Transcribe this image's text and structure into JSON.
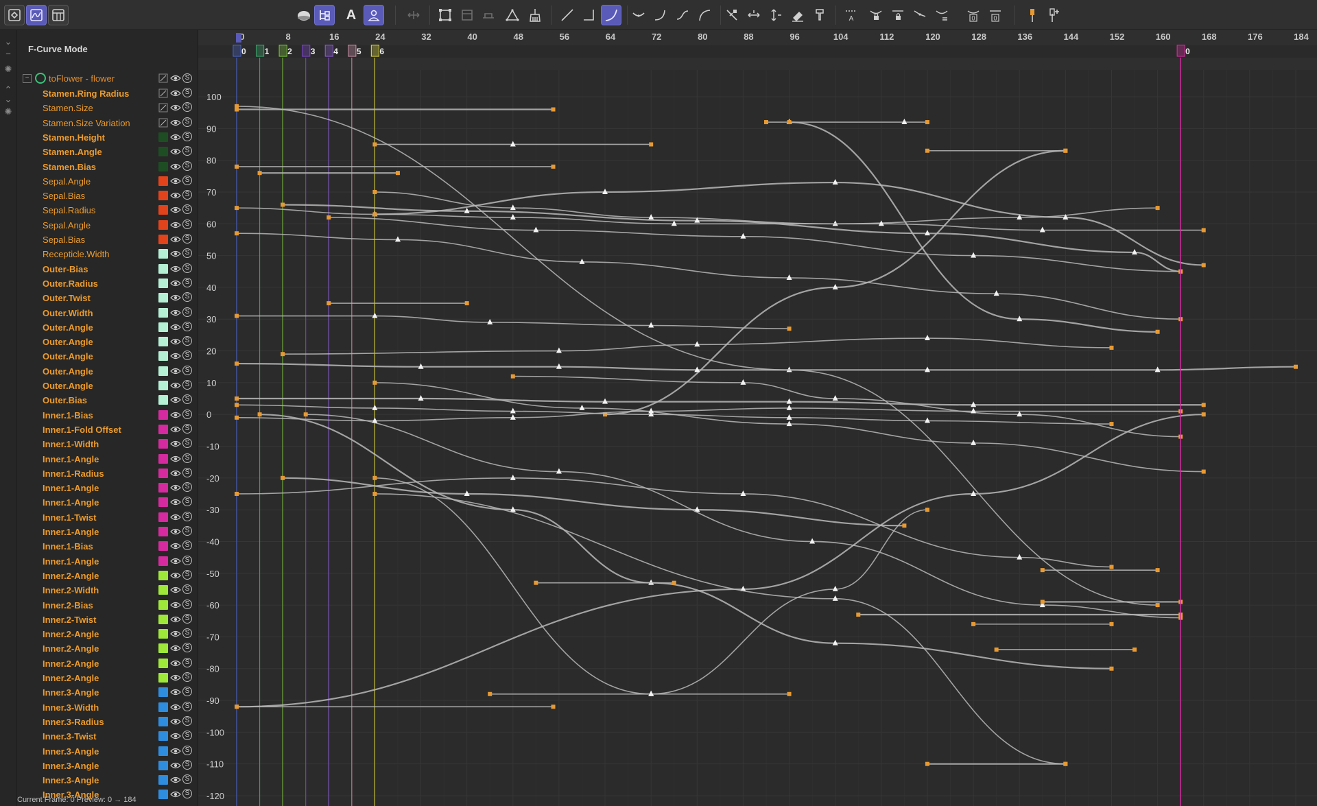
{
  "toolbar": {
    "text_tool_label": "A",
    "buttons": [
      "layout-key-icon",
      "fcurve-mode-icon",
      "dope-sheet-icon",
      "sphere-shading-icon",
      "hierarchy-icon",
      "text-tool-icon",
      "person-filter-icon",
      "move-icon",
      "frame-all-icon",
      "frame-selected-icon",
      "range-icon",
      "delta-icon",
      "broom-icon",
      "linear-curve-icon",
      "step-curve-icon",
      "ease-curve-icon",
      "bezier-smooth-icon",
      "ease-in-icon",
      "s-curve-icon",
      "ease-out-icon",
      "break-tangent-icon",
      "weight-horizontal-icon",
      "weight-vertical-icon",
      "eraser-icon",
      "stamp-icon",
      "auto-tangent-icon",
      "lock-tangent-icon",
      "lock-tangent-2-icon",
      "flat-tangent-icon",
      "tangent-equal-icon",
      "zero-tangent-icon",
      "zero-tangent-2-icon",
      "marker-icon",
      "add-marker-icon"
    ],
    "zero_labels": [
      "0",
      "0"
    ]
  },
  "panel": {
    "mode_label": "F-Curve Mode",
    "group_name": "toFlower - flower",
    "group_toggle": "−",
    "solo_label": "S"
  },
  "tracks": [
    {
      "name": "Stamen.Ring Radius",
      "color": "#1f4d23",
      "bold": true,
      "icon": "edit"
    },
    {
      "name": "Stamen.Size",
      "color": "#1f4d23",
      "bold": false,
      "icon": "edit"
    },
    {
      "name": "Stamen.Size Variation",
      "color": "#1f4d23",
      "bold": false,
      "icon": "edit"
    },
    {
      "name": "Stamen.Height",
      "color": "#1f4d23",
      "bold": true
    },
    {
      "name": "Stamen.Angle",
      "color": "#1f4d23",
      "bold": true
    },
    {
      "name": "Stamen.Bias",
      "color": "#1f4d23",
      "bold": true
    },
    {
      "name": "Sepal.Angle",
      "color": "#e2431b",
      "bold": false
    },
    {
      "name": "Sepal.Bias",
      "color": "#e2431b",
      "bold": false
    },
    {
      "name": "Sepal.Radius",
      "color": "#e2431b",
      "bold": false
    },
    {
      "name": "Sepal.Angle",
      "color": "#e2431b",
      "bold": false
    },
    {
      "name": "Sepal.Bias",
      "color": "#e2431b",
      "bold": false
    },
    {
      "name": "Recepticle.Width",
      "color": "#b5f0d4",
      "bold": false
    },
    {
      "name": "Outer-Bias",
      "color": "#b5f0d4",
      "bold": true
    },
    {
      "name": "Outer.Radius",
      "color": "#b5f0d4",
      "bold": true
    },
    {
      "name": "Outer.Twist",
      "color": "#b5f0d4",
      "bold": true
    },
    {
      "name": "Outer.Width",
      "color": "#b5f0d4",
      "bold": true
    },
    {
      "name": "Outer.Angle",
      "color": "#b5f0d4",
      "bold": true
    },
    {
      "name": "Outer.Angle",
      "color": "#b5f0d4",
      "bold": true
    },
    {
      "name": "Outer.Angle",
      "color": "#b5f0d4",
      "bold": true
    },
    {
      "name": "Outer.Angle",
      "color": "#b5f0d4",
      "bold": true
    },
    {
      "name": "Outer.Angle",
      "color": "#b5f0d4",
      "bold": true
    },
    {
      "name": "Outer.Bias",
      "color": "#b5f0d4",
      "bold": true
    },
    {
      "name": "Inner.1-Bias",
      "color": "#d62aa0",
      "bold": true
    },
    {
      "name": "Inner.1-Fold Offset",
      "color": "#d62aa0",
      "bold": true
    },
    {
      "name": "Inner.1-Width",
      "color": "#d62aa0",
      "bold": true
    },
    {
      "name": "Inner.1-Angle",
      "color": "#d62aa0",
      "bold": true
    },
    {
      "name": "Inner.1-Radius",
      "color": "#d62aa0",
      "bold": true
    },
    {
      "name": "Inner.1-Angle",
      "color": "#d62aa0",
      "bold": true
    },
    {
      "name": "Inner.1-Angle",
      "color": "#d62aa0",
      "bold": true
    },
    {
      "name": "Inner.1-Twist",
      "color": "#d62aa0",
      "bold": true
    },
    {
      "name": "Inner.1-Angle",
      "color": "#d62aa0",
      "bold": true
    },
    {
      "name": "Inner.1-Bias",
      "color": "#d62aa0",
      "bold": true
    },
    {
      "name": "Inner.1-Angle",
      "color": "#d62aa0",
      "bold": true
    },
    {
      "name": "Inner.2-Angle",
      "color": "#9ee83a",
      "bold": true
    },
    {
      "name": "Inner.2-Width",
      "color": "#9ee83a",
      "bold": true
    },
    {
      "name": "Inner.2-Bias",
      "color": "#9ee83a",
      "bold": true
    },
    {
      "name": "Inner.2-Twist",
      "color": "#9ee83a",
      "bold": true
    },
    {
      "name": "Inner.2-Angle",
      "color": "#9ee83a",
      "bold": true
    },
    {
      "name": "Inner.2-Angle",
      "color": "#9ee83a",
      "bold": true
    },
    {
      "name": "Inner.2-Angle",
      "color": "#9ee83a",
      "bold": true
    },
    {
      "name": "Inner.2-Angle",
      "color": "#9ee83a",
      "bold": true
    },
    {
      "name": "Inner.3-Angle",
      "color": "#2f8de0",
      "bold": true
    },
    {
      "name": "Inner.3-Width",
      "color": "#2f8de0",
      "bold": true
    },
    {
      "name": "Inner.3-Radius",
      "color": "#2f8de0",
      "bold": true
    },
    {
      "name": "Inner.3-Twist",
      "color": "#2f8de0",
      "bold": true
    },
    {
      "name": "Inner.3-Angle",
      "color": "#2f8de0",
      "bold": true
    },
    {
      "name": "Inner.3-Angle",
      "color": "#2f8de0",
      "bold": true
    },
    {
      "name": "Inner.3-Angle",
      "color": "#2f8de0",
      "bold": true
    },
    {
      "name": "Inner.3-Angle",
      "color": "#2f8de0",
      "bold": true
    }
  ],
  "status": {
    "text": "Current Frame: 0  Preview: 0 → 184"
  },
  "timeline": {
    "frame_ticks": [
      0,
      8,
      16,
      24,
      32,
      40,
      48,
      56,
      64,
      72,
      80,
      88,
      96,
      104,
      112,
      120,
      128,
      136,
      144,
      152,
      160,
      168,
      176,
      184
    ],
    "current_frame": 0,
    "markers": [
      {
        "label": "0",
        "frame": 0,
        "color": "#4a63c8"
      },
      {
        "label": "1",
        "frame": 4,
        "color": "#3aa36a"
      },
      {
        "label": "2",
        "frame": 8,
        "color": "#77c23a"
      },
      {
        "label": "3",
        "frame": 12,
        "color": "#7a44c8"
      },
      {
        "label": "4",
        "frame": 16,
        "color": "#8a5bd0"
      },
      {
        "label": "5",
        "frame": 20,
        "color": "#c28aa0"
      },
      {
        "label": "6",
        "frame": 24,
        "color": "#d8d23a"
      },
      {
        "label": "0",
        "frame": 164,
        "color": "#d62aa0"
      }
    ],
    "value_ticks": [
      100,
      90,
      80,
      70,
      60,
      50,
      40,
      30,
      20,
      10,
      0,
      -10,
      -20,
      -30,
      -40,
      -50,
      -60,
      -70,
      -80,
      -90,
      -100,
      -110,
      -120
    ]
  },
  "colors": {
    "key": "#e89a32",
    "curve": "#b9b9b9",
    "accent": "#5a5ab8",
    "end_line": "#d62aa0"
  },
  "chart_data": {
    "type": "line",
    "title": "",
    "xlabel": "",
    "ylabel": "",
    "xlim": [
      0,
      184
    ],
    "ylim": [
      -120,
      100
    ],
    "series": [
      {
        "values": [
          [
            0,
            96
          ],
          [
            55,
            96
          ]
        ]
      },
      {
        "values": [
          [
            24,
            85
          ],
          [
            48,
            85
          ],
          [
            72,
            85
          ]
        ]
      },
      {
        "values": [
          [
            0,
            78
          ],
          [
            55,
            78
          ]
        ]
      },
      {
        "values": [
          [
            4,
            76
          ],
          [
            28,
            76
          ]
        ]
      },
      {
        "values": [
          [
            0,
            97
          ],
          [
            96,
            14
          ],
          [
            160,
            -60
          ]
        ]
      },
      {
        "values": [
          [
            92,
            92
          ],
          [
            96,
            92
          ],
          [
            116,
            92
          ],
          [
            120,
            92
          ]
        ]
      },
      {
        "values": [
          [
            96,
            92
          ],
          [
            136,
            30
          ],
          [
            160,
            26
          ]
        ]
      },
      {
        "values": [
          [
            120,
            83
          ],
          [
            144,
            83
          ]
        ]
      },
      {
        "values": [
          [
            16,
            35
          ],
          [
            40,
            35
          ]
        ]
      },
      {
        "values": [
          [
            144,
            83
          ],
          [
            104,
            40
          ],
          [
            64,
            0
          ]
        ]
      },
      {
        "values": [
          [
            0,
            31
          ],
          [
            24,
            31
          ],
          [
            44,
            29
          ],
          [
            72,
            28
          ],
          [
            96,
            27
          ]
        ]
      },
      {
        "values": [
          [
            8,
            19
          ],
          [
            56,
            20
          ],
          [
            80,
            22
          ],
          [
            120,
            24
          ],
          [
            152,
            21
          ]
        ]
      },
      {
        "values": [
          [
            0,
            16
          ],
          [
            32,
            15
          ],
          [
            56,
            15
          ],
          [
            80,
            14
          ],
          [
            120,
            14
          ],
          [
            160,
            14
          ],
          [
            184,
            15
          ]
        ]
      },
      {
        "values": [
          [
            24,
            70
          ],
          [
            48,
            65
          ],
          [
            72,
            62
          ],
          [
            104,
            60
          ],
          [
            136,
            62
          ],
          [
            160,
            65
          ]
        ]
      },
      {
        "values": [
          [
            0,
            65
          ],
          [
            24,
            63
          ],
          [
            48,
            62
          ],
          [
            76,
            60
          ],
          [
            112,
            60
          ],
          [
            140,
            58
          ],
          [
            168,
            58
          ]
        ]
      },
      {
        "values": [
          [
            8,
            66
          ],
          [
            40,
            64
          ],
          [
            80,
            61
          ],
          [
            120,
            57
          ],
          [
            156,
            51
          ],
          [
            164,
            45
          ]
        ]
      },
      {
        "values": [
          [
            0,
            57
          ],
          [
            28,
            55
          ],
          [
            60,
            48
          ],
          [
            96,
            43
          ],
          [
            132,
            38
          ],
          [
            164,
            30
          ]
        ]
      },
      {
        "values": [
          [
            16,
            62
          ],
          [
            52,
            58
          ],
          [
            88,
            56
          ],
          [
            128,
            50
          ],
          [
            164,
            45
          ]
        ]
      },
      {
        "values": [
          [
            24,
            63
          ],
          [
            64,
            70
          ],
          [
            104,
            73
          ],
          [
            144,
            62
          ],
          [
            168,
            47
          ]
        ]
      },
      {
        "values": [
          [
            48,
            12
          ],
          [
            88,
            10
          ],
          [
            104,
            5
          ],
          [
            136,
            0
          ],
          [
            164,
            -7
          ]
        ]
      },
      {
        "values": [
          [
            24,
            10
          ],
          [
            60,
            2
          ],
          [
            96,
            -3
          ],
          [
            128,
            -9
          ],
          [
            168,
            -18
          ]
        ]
      },
      {
        "values": [
          [
            8,
            -20
          ],
          [
            40,
            -25
          ],
          [
            80,
            -30
          ],
          [
            116,
            -35
          ]
        ]
      },
      {
        "values": [
          [
            0,
            -25
          ],
          [
            48,
            -20
          ],
          [
            88,
            -25
          ],
          [
            136,
            -45
          ],
          [
            152,
            -48
          ]
        ]
      },
      {
        "values": [
          [
            12,
            0
          ],
          [
            56,
            -18
          ],
          [
            100,
            -40
          ],
          [
            140,
            -60
          ],
          [
            164,
            -64
          ]
        ]
      },
      {
        "values": [
          [
            4,
            0
          ],
          [
            48,
            -30
          ],
          [
            72,
            -53
          ],
          [
            104,
            -72
          ],
          [
            152,
            -80
          ]
        ]
      },
      {
        "values": [
          [
            24,
            -20
          ],
          [
            72,
            -88
          ],
          [
            104,
            -55
          ],
          [
            120,
            -30
          ]
        ]
      },
      {
        "values": [
          [
            0,
            -92
          ],
          [
            55,
            -92
          ]
        ]
      },
      {
        "values": [
          [
            0,
            -92
          ],
          [
            88,
            -55
          ],
          [
            128,
            -25
          ],
          [
            168,
            0
          ]
        ]
      },
      {
        "values": [
          [
            44,
            -88
          ],
          [
            72,
            -88
          ],
          [
            96,
            -88
          ]
        ]
      },
      {
        "values": [
          [
            24,
            -25
          ],
          [
            104,
            -58
          ],
          [
            144,
            -110
          ]
        ]
      },
      {
        "values": [
          [
            120,
            -110
          ],
          [
            144,
            -110
          ]
        ]
      },
      {
        "values": [
          [
            52,
            -53
          ],
          [
            76,
            -53
          ]
        ]
      },
      {
        "values": [
          [
            140,
            -49
          ],
          [
            160,
            -49
          ]
        ]
      },
      {
        "values": [
          [
            140,
            -59
          ],
          [
            164,
            -59
          ]
        ]
      },
      {
        "values": [
          [
            128,
            -66
          ],
          [
            152,
            -66
          ]
        ]
      },
      {
        "values": [
          [
            132,
            -74
          ],
          [
            156,
            -74
          ]
        ]
      },
      {
        "values": [
          [
            108,
            -63
          ],
          [
            164,
            -63
          ]
        ]
      },
      {
        "values": [
          [
            0,
            3
          ],
          [
            24,
            2
          ],
          [
            48,
            1
          ],
          [
            72,
            0
          ],
          [
            96,
            -1
          ],
          [
            120,
            -2
          ],
          [
            152,
            -3
          ]
        ]
      },
      {
        "values": [
          [
            0,
            -1
          ],
          [
            24,
            -2
          ],
          [
            48,
            -1
          ],
          [
            72,
            1
          ],
          [
            96,
            2
          ],
          [
            128,
            1
          ],
          [
            164,
            1
          ]
        ]
      },
      {
        "values": [
          [
            0,
            5
          ],
          [
            32,
            5
          ],
          [
            64,
            4
          ],
          [
            96,
            4
          ],
          [
            128,
            3
          ],
          [
            168,
            3
          ]
        ]
      }
    ]
  }
}
